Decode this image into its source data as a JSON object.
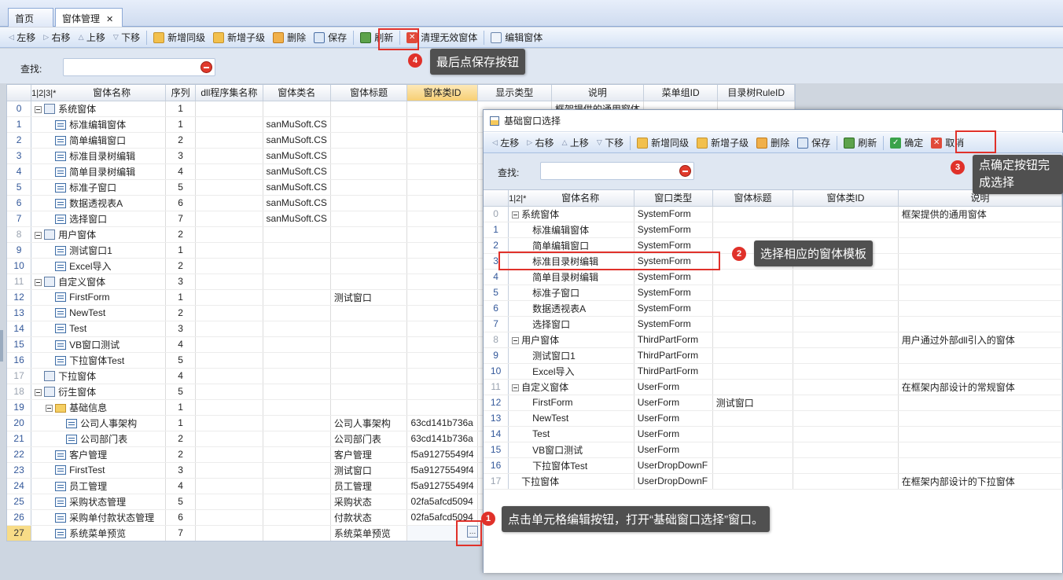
{
  "tabs": [
    {
      "label": "首页"
    },
    {
      "label": "窗体管理"
    }
  ],
  "toolbar": {
    "move_left": "左移",
    "move_right": "右移",
    "move_up": "上移",
    "move_down": "下移",
    "add_sibling": "新增同级",
    "add_child": "新增子级",
    "delete": "删除",
    "save": "保存",
    "refresh": "刷新",
    "clear_invalid": "清理无效窗体",
    "edit_form": "编辑窗体"
  },
  "search": {
    "label": "查找:",
    "value": ""
  },
  "main_grid": {
    "level_headers": [
      "1",
      "2",
      "3",
      "*"
    ],
    "columns": [
      "窗体名称",
      "序列",
      "dll程序集名称",
      "窗体类名",
      "窗体标题",
      "窗体类ID",
      "显示类型",
      "说明",
      "菜单组ID",
      "目录树RuleID"
    ],
    "rows": [
      {
        "rn": "0",
        "name": "系统窗体",
        "seq": "1",
        "cls": "",
        "title": "",
        "id": "",
        "note": "框架提供的通用窗体"
      },
      {
        "rn": "1",
        "name": "标准编辑窗体",
        "seq": "1",
        "cls": "sanMuSoft.CS",
        "title": "",
        "id": ""
      },
      {
        "rn": "2",
        "name": "简单编辑窗口",
        "seq": "2",
        "cls": "sanMuSoft.CS",
        "title": "",
        "id": ""
      },
      {
        "rn": "3",
        "name": "标准目录树编辑",
        "seq": "3",
        "cls": "sanMuSoft.CS",
        "title": "",
        "id": ""
      },
      {
        "rn": "4",
        "name": "简单目录树编辑",
        "seq": "4",
        "cls": "sanMuSoft.CS",
        "title": "",
        "id": ""
      },
      {
        "rn": "5",
        "name": "标准子窗口",
        "seq": "5",
        "cls": "sanMuSoft.CS",
        "title": "",
        "id": ""
      },
      {
        "rn": "6",
        "name": "数据透视表A",
        "seq": "6",
        "cls": "sanMuSoft.CS",
        "title": "",
        "id": ""
      },
      {
        "rn": "7",
        "name": "选择窗口",
        "seq": "7",
        "cls": "sanMuSoft.CS",
        "title": "",
        "id": ""
      },
      {
        "rn": "8",
        "name": "用户窗体",
        "seq": "2",
        "cls": "",
        "title": "",
        "id": ""
      },
      {
        "rn": "9",
        "name": "测试窗口1",
        "seq": "1",
        "cls": "",
        "title": "",
        "id": ""
      },
      {
        "rn": "10",
        "name": "Excel导入",
        "seq": "2",
        "cls": "",
        "title": "",
        "id": ""
      },
      {
        "rn": "11",
        "name": "自定义窗体",
        "seq": "3",
        "cls": "",
        "title": "",
        "id": ""
      },
      {
        "rn": "12",
        "name": "FirstForm",
        "seq": "1",
        "cls": "",
        "title": "测试窗口",
        "id": ""
      },
      {
        "rn": "13",
        "name": "NewTest",
        "seq": "2",
        "cls": "",
        "title": "",
        "id": ""
      },
      {
        "rn": "14",
        "name": "Test",
        "seq": "3",
        "cls": "",
        "title": "",
        "id": ""
      },
      {
        "rn": "15",
        "name": "VB窗口测试",
        "seq": "4",
        "cls": "",
        "title": "",
        "id": ""
      },
      {
        "rn": "16",
        "name": "下拉窗体Test",
        "seq": "5",
        "cls": "",
        "title": "",
        "id": ""
      },
      {
        "rn": "17",
        "name": "下拉窗体",
        "seq": "4",
        "cls": "",
        "title": "",
        "id": ""
      },
      {
        "rn": "18",
        "name": "衍生窗体",
        "seq": "5",
        "cls": "",
        "title": "",
        "id": ""
      },
      {
        "rn": "19",
        "name": "基础信息",
        "seq": "1",
        "cls": "",
        "title": "",
        "id": ""
      },
      {
        "rn": "20",
        "name": "公司人事架构",
        "seq": "1",
        "cls": "",
        "title": "公司人事架构",
        "id": "63cd141b736a"
      },
      {
        "rn": "21",
        "name": "公司部门表",
        "seq": "2",
        "cls": "",
        "title": "公司部门表",
        "id": "63cd141b736a"
      },
      {
        "rn": "22",
        "name": "客户管理",
        "seq": "2",
        "cls": "",
        "title": "客户管理",
        "id": "f5a91275549f4"
      },
      {
        "rn": "23",
        "name": "FirstTest",
        "seq": "3",
        "cls": "",
        "title": "测试窗口",
        "id": "f5a91275549f4"
      },
      {
        "rn": "24",
        "name": "员工管理",
        "seq": "4",
        "cls": "",
        "title": "员工管理",
        "id": "f5a91275549f4"
      },
      {
        "rn": "25",
        "name": "采购状态管理",
        "seq": "5",
        "cls": "",
        "title": "采购状态",
        "id": "02fa5afcd5094"
      },
      {
        "rn": "26",
        "name": "采购单付款状态管理",
        "seq": "6",
        "cls": "",
        "title": "付款状态",
        "id": "02fa5afcd5094"
      },
      {
        "rn": "27",
        "name": "系统菜单预览",
        "seq": "7",
        "cls": "",
        "title": "系统菜单预览",
        "id": ""
      }
    ]
  },
  "dialog": {
    "title": "基础窗口选择",
    "toolbar": {
      "move_left": "左移",
      "move_right": "右移",
      "move_up": "上移",
      "move_down": "下移",
      "add_sibling": "新增同级",
      "add_child": "新增子级",
      "delete": "删除",
      "save": "保存",
      "refresh": "刷新",
      "ok": "确定",
      "cancel": "取消"
    },
    "search_label": "查找:",
    "level_headers": [
      "1",
      "2",
      "*"
    ],
    "columns": [
      "窗体名称",
      "窗口类型",
      "窗体标题",
      "窗体类ID",
      "说明"
    ],
    "rows": [
      {
        "rn": "0",
        "name": "系统窗体",
        "type": "SystemForm",
        "title": "",
        "note": "框架提供的通用窗体"
      },
      {
        "rn": "1",
        "name": "标准编辑窗体",
        "type": "SystemForm",
        "title": "",
        "note": ""
      },
      {
        "rn": "2",
        "name": "简单编辑窗口",
        "type": "SystemForm",
        "title": "",
        "note": ""
      },
      {
        "rn": "3",
        "name": "标准目录树编辑",
        "type": "SystemForm",
        "title": "",
        "note": ""
      },
      {
        "rn": "4",
        "name": "简单目录树编辑",
        "type": "SystemForm",
        "title": "",
        "note": ""
      },
      {
        "rn": "5",
        "name": "标准子窗口",
        "type": "SystemForm",
        "title": "",
        "note": ""
      },
      {
        "rn": "6",
        "name": "数据透视表A",
        "type": "SystemForm",
        "title": "",
        "note": ""
      },
      {
        "rn": "7",
        "name": "选择窗口",
        "type": "SystemForm",
        "title": "",
        "note": ""
      },
      {
        "rn": "8",
        "name": "用户窗体",
        "type": "ThirdPartForm",
        "title": "",
        "note": "用户通过外部dll引入的窗体"
      },
      {
        "rn": "9",
        "name": "测试窗口1",
        "type": "ThirdPartForm",
        "title": "",
        "note": ""
      },
      {
        "rn": "10",
        "name": "Excel导入",
        "type": "ThirdPartForm",
        "title": "",
        "note": ""
      },
      {
        "rn": "11",
        "name": "自定义窗体",
        "type": "UserForm",
        "title": "",
        "note": "在框架内部设计的常规窗体"
      },
      {
        "rn": "12",
        "name": "FirstForm",
        "type": "UserForm",
        "title": "测试窗口",
        "note": ""
      },
      {
        "rn": "13",
        "name": "NewTest",
        "type": "UserForm",
        "title": "",
        "note": ""
      },
      {
        "rn": "14",
        "name": "Test",
        "type": "UserForm",
        "title": "",
        "note": ""
      },
      {
        "rn": "15",
        "name": "VB窗口测试",
        "type": "UserForm",
        "title": "",
        "note": ""
      },
      {
        "rn": "16",
        "name": "下拉窗体Test",
        "type": "UserDropDownF",
        "title": "",
        "note": ""
      },
      {
        "rn": "17",
        "name": "下拉窗体",
        "type": "UserDropDownF",
        "title": "",
        "note": "在框架内部设计的下拉窗体"
      }
    ]
  },
  "callouts": {
    "c1": "点击单元格编辑按钮，打开“基础窗口选择”窗口。",
    "c2": "选择相应的窗体模板",
    "c3a": "点确定按钮完",
    "c3b": "成选择",
    "c4": "最后点保存按钮"
  },
  "badges": [
    "1",
    "2",
    "3",
    "4"
  ],
  "colors": {
    "accent_red": "#e0312a",
    "callout_bg": "#505050",
    "selected_header": "#f7cf74",
    "tree_blue": "#3f6ea6"
  }
}
